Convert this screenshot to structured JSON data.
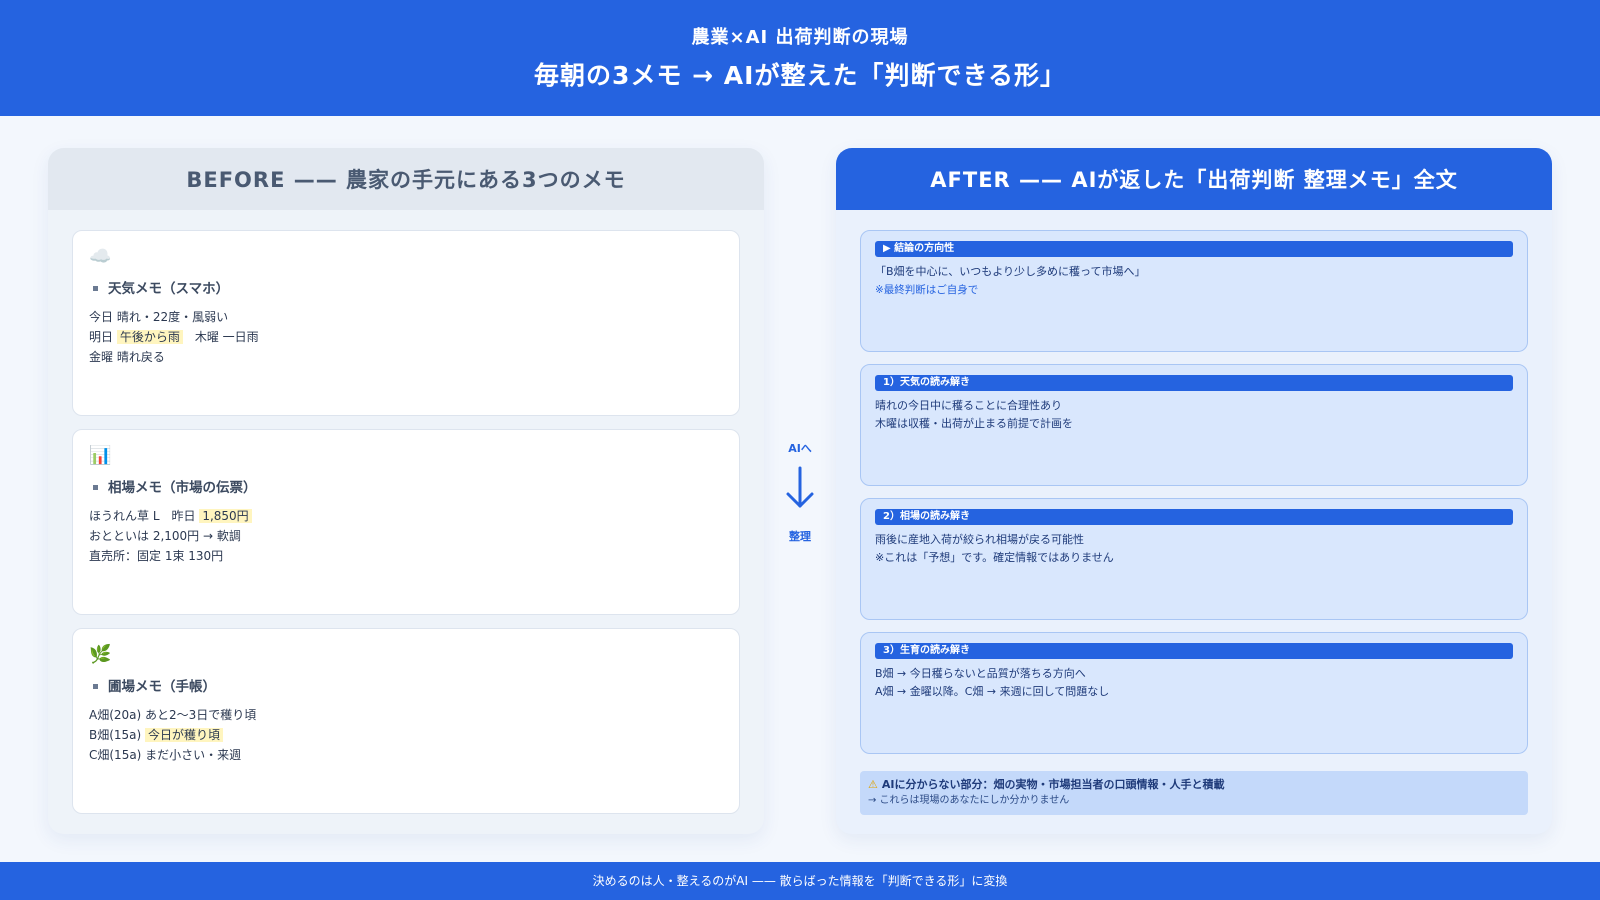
{
  "header": {
    "subtitle": "農業×AI 出荷判断の現場",
    "title": "毎朝の3メモ → AIが整えた「判断できる形」"
  },
  "before": {
    "heading": "BEFORE —— 農家の手元にある3つのメモ",
    "memos": [
      {
        "icon": "cloud-icon",
        "emoji": "☁️",
        "title": "天気メモ（スマホ）",
        "lines": [
          {
            "pre": "今日 晴れ・22度・風弱い",
            "hl": "",
            "post": ""
          },
          {
            "pre": "明日 ",
            "hl": "午後から雨",
            "post": "　木曜 一日雨"
          },
          {
            "pre": "金曜 晴れ戻る",
            "hl": "",
            "post": ""
          }
        ]
      },
      {
        "icon": "chart-icon",
        "emoji": "📊",
        "title": "相場メモ（市場の伝票）",
        "lines": [
          {
            "pre": "ほうれん草 L　昨日 ",
            "hl": "1,850円",
            "post": ""
          },
          {
            "pre": "おとといは 2,100円 → 軟調",
            "hl": "",
            "post": ""
          },
          {
            "pre": "直売所：固定 1束 130円",
            "hl": "",
            "post": ""
          }
        ]
      },
      {
        "icon": "herb-icon",
        "emoji": "🌿",
        "title": "圃場メモ（手帳）",
        "lines": [
          {
            "pre": "A畑(20a) あと2〜3日で穫り頃",
            "hl": "",
            "post": ""
          },
          {
            "pre": "B畑(15a) ",
            "hl": "今日が穫り頃",
            "post": ""
          },
          {
            "pre": "C畑(15a) まだ小さい・来週",
            "hl": "",
            "post": ""
          }
        ]
      }
    ]
  },
  "arrow": {
    "top": "AIへ",
    "bottom": "整理"
  },
  "after": {
    "heading": "AFTER —— AIが返した「出荷判断 整理メモ」全文",
    "cards": [
      {
        "label": "▶ 結論の方向性",
        "line1": "「B畑を中心に、いつもより少し多めに穫って市場へ」",
        "line2": "※最終判断はご自身で",
        "note": true
      },
      {
        "label": "1）天気の読み解き",
        "line1": "晴れの今日中に穫ることに合理性あり",
        "line2": "木曜は収穫・出荷が止まる前提で計画を",
        "note": false
      },
      {
        "label": "2）相場の読み解き",
        "line1": "雨後に産地入荷が絞られ相場が戻る可能性",
        "line2": "※これは「予想」です。確定情報ではありません",
        "note": false
      },
      {
        "label": "3）生育の読み解き",
        "line1": "B畑 → 今日穫らないと品質が落ちる方向へ",
        "line2": "A畑 → 金曜以降。C畑 → 来週に回して問題なし",
        "note": false
      }
    ],
    "warning": {
      "icon": "warning-icon",
      "line1": "AIに分からない部分：畑の実物・市場担当者の口頭情報・人手と積載",
      "line2": "→ これらは現場のあなたにしか分かりません"
    }
  },
  "footer": {
    "text": "決めるのは人・整えるのがAI —— 散らばった情報を「判断できる形」に変換"
  }
}
